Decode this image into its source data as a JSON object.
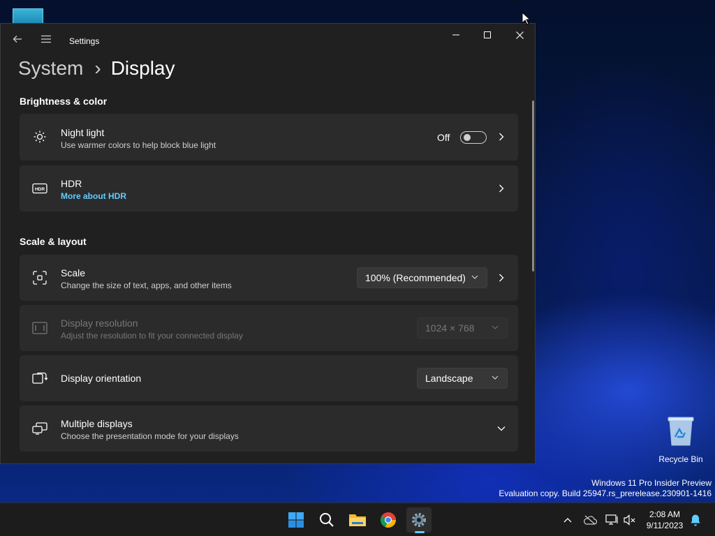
{
  "window": {
    "app_title": "Settings",
    "breadcrumb_parent": "System",
    "breadcrumb_separator": "›",
    "page_title": "Display"
  },
  "sections": {
    "brightness": "Brightness & color",
    "scale_layout": "Scale & layout"
  },
  "night_light": {
    "title": "Night light",
    "subtitle": "Use warmer colors to help block blue light",
    "state_label": "Off",
    "enabled": false
  },
  "hdr": {
    "title": "HDR",
    "link": "More about HDR"
  },
  "scale": {
    "title": "Scale",
    "subtitle": "Change the size of text, apps, and other items",
    "value": "100% (Recommended)"
  },
  "resolution": {
    "title": "Display resolution",
    "subtitle": "Adjust the resolution to fit your connected display",
    "value": "1024 × 768",
    "disabled": true
  },
  "orientation": {
    "title": "Display orientation",
    "value": "Landscape"
  },
  "multiple": {
    "title": "Multiple displays",
    "subtitle": "Choose the presentation mode for your displays"
  },
  "desktop": {
    "recycle_bin": "Recycle Bin",
    "watermark_line1": "Windows 11 Pro Insider Preview",
    "watermark_line2": "Evaluation copy. Build 25947.rs_prerelease.230901-1416"
  },
  "taskbar": {
    "apps": [
      "start-icon",
      "search-icon",
      "file-explorer-icon",
      "chrome-icon",
      "settings-icon"
    ],
    "time": "2:08 AM",
    "date": "9/11/2023"
  },
  "colors": {
    "accent": "#60cdff",
    "window_bg": "#202020",
    "card_bg": "#2b2b2b"
  }
}
